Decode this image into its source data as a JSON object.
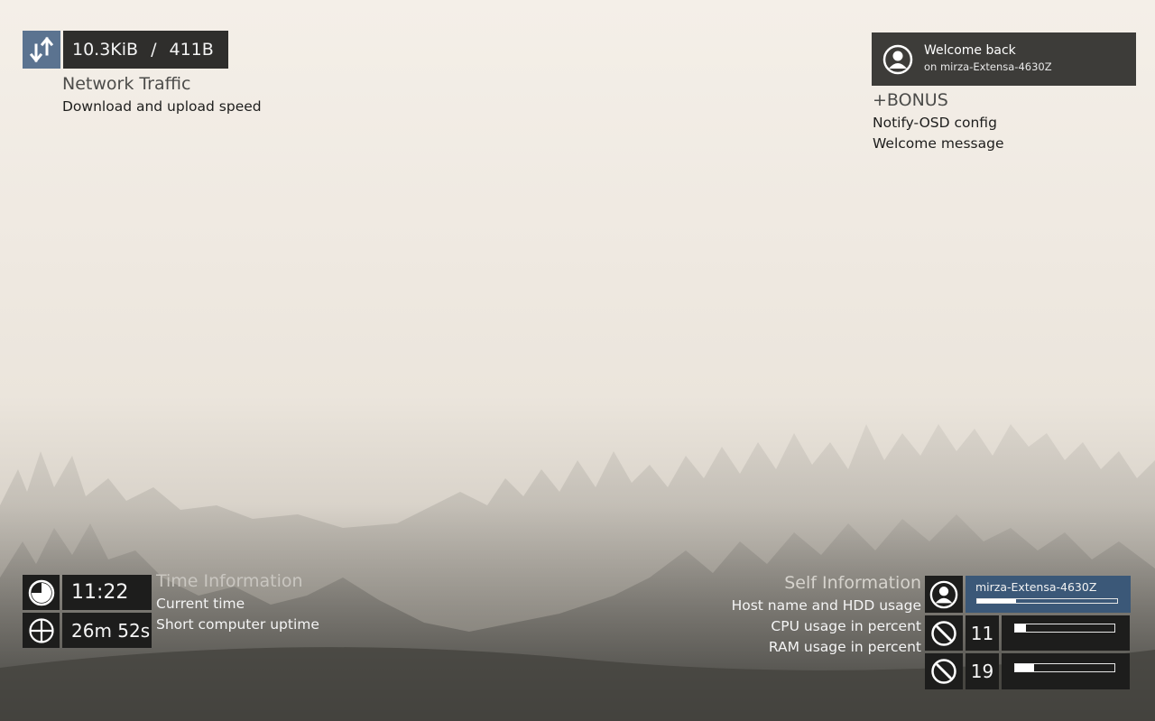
{
  "network": {
    "download": "10.3KiB",
    "separator": "/",
    "upload": "411B",
    "title": "Network Traffic",
    "subtitle": "Download and upload speed",
    "icon": "up-down-arrows-icon"
  },
  "welcome": {
    "heading": "Welcome back",
    "host_line": "on mirza-Extensa-4630Z",
    "icon": "user-avatar-icon"
  },
  "bonus": {
    "title": "+BONUS",
    "lines": [
      "Notify-OSD config",
      "Welcome message"
    ]
  },
  "time_info": {
    "clock": "11:22",
    "uptime": "26m 52s",
    "title": "Time Information",
    "lines": [
      "Current time",
      "Short computer uptime"
    ],
    "clock_icon": "pie-clock-icon",
    "uptime_icon": "crosshair-icon"
  },
  "self_info": {
    "title": "Self Information",
    "lines": [
      "Host name and HDD usage",
      "CPU usage in percent",
      "RAM usage in percent"
    ],
    "hostname": "mirza-Extensa-4630Z",
    "hdd_usage_fraction": 0.28,
    "cpu": "11",
    "cpu_fraction": 0.11,
    "ram": "19",
    "ram_fraction": 0.19,
    "host_icon": "user-avatar-icon",
    "cpu_icon": "gauge-icon",
    "ram_icon": "gauge-icon",
    "accent_color": "#3b5878"
  }
}
